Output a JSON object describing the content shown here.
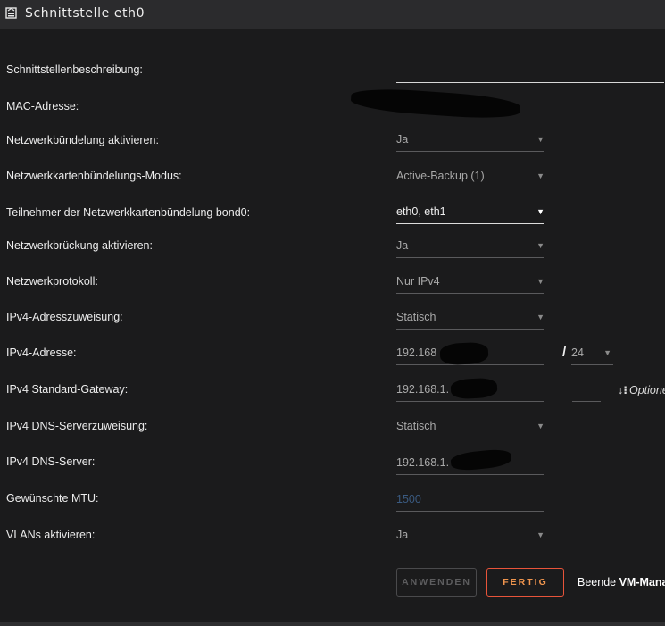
{
  "window": {
    "title": "Schnittstelle eth0",
    "icon": "network-icon"
  },
  "form": {
    "description_label": "Schnittstellenbeschreibung:",
    "mac_label": "MAC-Adresse:",
    "bonding_label": "Netzwerkbündelung aktivieren:",
    "bonding_value": "Ja",
    "bonding_mode_label": "Netzwerkkartenbündelungs-Modus:",
    "bonding_mode_value": "Active-Backup (1)",
    "bond_members_label": "Teilnehmer der Netzwerkkartenbündelung bond0:",
    "bond_members_value": "eth0, eth1",
    "bridge_label": "Netzwerkbrückung aktivieren:",
    "bridge_value": "Ja",
    "protocol_label": "Netzwerkprotokoll:",
    "protocol_value": "Nur IPv4",
    "ipv4_assign_label": "IPv4-Adresszuweisung:",
    "ipv4_assign_value": "Statisch",
    "ipv4_address_label": "IPv4-Adresse:",
    "ipv4_address_value": "192.168",
    "prefix_slash": "/",
    "prefix_value": "24",
    "gateway_label": "IPv4 Standard-Gateway:",
    "gateway_value": "192.168.1.",
    "options_label": "Optionen",
    "dns_assign_label": "IPv4 DNS-Serverzuweisung:",
    "dns_assign_value": "Statisch",
    "dns_server_label": "IPv4 DNS-Server:",
    "dns_server_value": "192.168.1.",
    "mtu_label": "Gewünschte MTU:",
    "mtu_value": "1500",
    "vlan_label": "VLANs aktivieren:",
    "vlan_value": "Ja"
  },
  "actions": {
    "apply_label": "ANWENDEN",
    "done_label": "FERTIG",
    "footnote_prefix": "Beende ",
    "footnote_bold": "VM-Mana"
  },
  "colors": {
    "background": "#1b1b1c",
    "accent_border": "#e8543a",
    "accent_text": "#f0954e"
  }
}
